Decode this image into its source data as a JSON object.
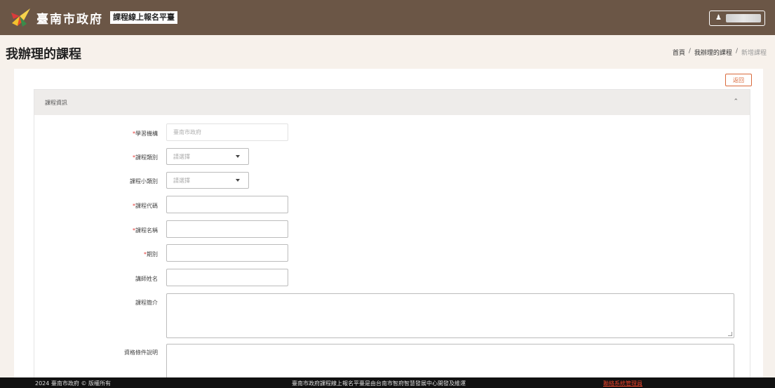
{
  "header": {
    "org_name": "臺南市政府",
    "platform_label": "課程線上報名平臺",
    "user_icon": "person-icon"
  },
  "page": {
    "title": "我辦理的課程",
    "breadcrumb": [
      {
        "label": "首頁"
      },
      {
        "label": "我辦理的課程"
      },
      {
        "label": "新增課程"
      }
    ],
    "breadcrumb_sep": "/"
  },
  "form": {
    "back_label": "返回",
    "section_title": "課程資訊",
    "collapse_icon": "chevron-up-icon",
    "fields": {
      "institution": {
        "label": "學習機構",
        "required": "*",
        "value": "臺南市政府"
      },
      "category": {
        "label": "課程類別",
        "required": "*",
        "value": "請選擇"
      },
      "subcategory": {
        "label": "課程小類別",
        "value": "請選擇"
      },
      "code": {
        "label": "課程代碼",
        "required": "*",
        "value": ""
      },
      "name": {
        "label": "課程名稱",
        "required": "*",
        "value": ""
      },
      "term": {
        "label": "期別",
        "required": "*",
        "value": ""
      },
      "teacher": {
        "label": "講師姓名",
        "value": ""
      },
      "intro": {
        "label": "課程簡介",
        "value": ""
      },
      "qualification": {
        "label": "資格條件說明",
        "value": ""
      }
    }
  },
  "footer": {
    "copyright": "2024 臺南市政府 © 版權所有",
    "credit": "臺南市政府課程線上報名平臺是由台南市智府智慧發展中心開發及維運",
    "contact_link": "聯絡系統管理員"
  },
  "colors": {
    "topbar": "#6b5646",
    "accent": "#d9693b",
    "required": "#e53935",
    "footer": "#111111"
  }
}
